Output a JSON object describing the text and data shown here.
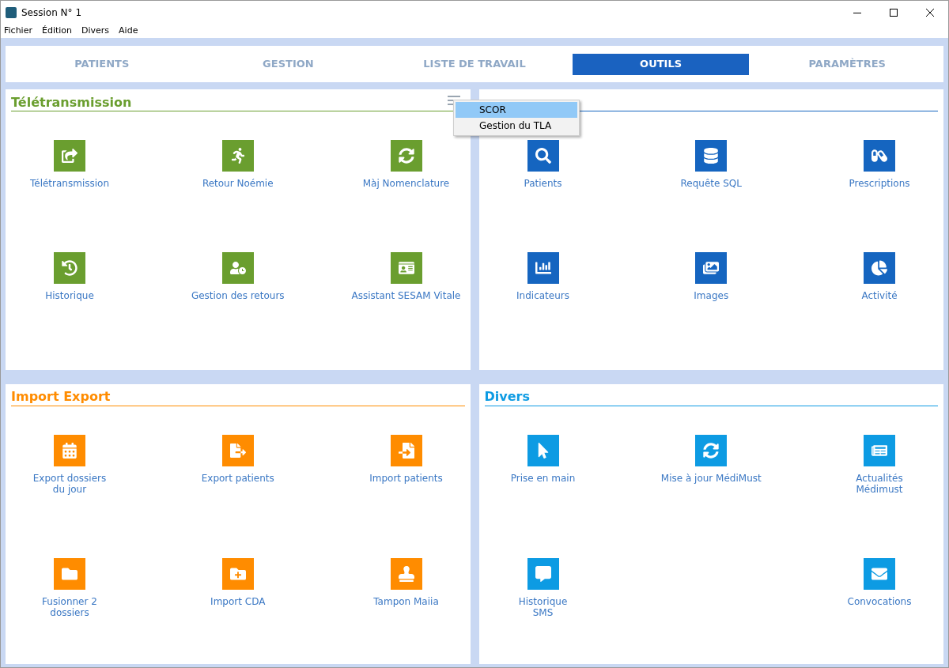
{
  "window": {
    "title": "Session N° 1"
  },
  "menu_bar": [
    "Fichier",
    "Édition",
    "Divers",
    "Aide"
  ],
  "tabs": [
    {
      "label": "PATIENTS",
      "selected": false
    },
    {
      "label": "GESTION",
      "selected": false
    },
    {
      "label": "LISTE DE TRAVAIL",
      "selected": false
    },
    {
      "label": "OUTILS",
      "selected": true
    },
    {
      "label": "PARAMÈTRES",
      "selected": false
    }
  ],
  "panels": [
    {
      "title": "Télétransmission",
      "color": "#6a9e2f",
      "has_menu": true,
      "tiles": [
        {
          "kind": "tile",
          "label": "Télétransmission"
        },
        {
          "kind": "tile",
          "label": "Retour Noémie"
        },
        {
          "kind": "tile",
          "label": "Màj Nomenclature"
        },
        {
          "kind": "tile",
          "label": "Historique"
        },
        {
          "kind": "tile",
          "label": "Gestion des retours"
        },
        {
          "kind": "tile",
          "label": "Assistant SESAM Vitale"
        }
      ]
    },
    {
      "color": "#1565c0",
      "has_menu": false,
      "tiles": [
        {
          "kind": "tile",
          "label": "Patients"
        },
        {
          "kind": "tile",
          "label": "Requête SQL"
        },
        {
          "kind": "tile",
          "label": "Prescriptions"
        },
        {
          "kind": "tile",
          "label": "Indicateurs"
        },
        {
          "kind": "tile",
          "label": "Images"
        },
        {
          "kind": "tile",
          "label": "Activité"
        }
      ]
    },
    {
      "title": "Import Export",
      "color": "#ff8c00",
      "has_menu": false,
      "tiles": [
        {
          "kind": "tile",
          "label": "Export dossiers\ndu jour"
        },
        {
          "kind": "tile",
          "label": "Export patients"
        },
        {
          "kind": "tile",
          "label": "Import patients"
        },
        {
          "kind": "tile",
          "label": "Fusionner 2\ndossiers"
        },
        {
          "kind": "tile",
          "label": "Import CDA"
        },
        {
          "kind": "tile",
          "label": "Tampon Maiia"
        }
      ]
    },
    {
      "title": "Divers",
      "color": "#0d9be3",
      "has_menu": false,
      "tiles": [
        {
          "kind": "tile",
          "label": "Prise en main"
        },
        {
          "kind": "tile",
          "label": "Mise à jour MédiMust"
        },
        {
          "kind": "tile",
          "label": "Actualités\nMédimust"
        },
        {
          "kind": "tile",
          "label": "Historique\nSMS"
        },
        {
          "kind": "blank"
        },
        {
          "kind": "tile",
          "label": "Convocations"
        }
      ]
    }
  ],
  "context_menu": {
    "items": [
      {
        "label": "SCOR",
        "selected": true
      },
      {
        "label": "Gestion du TLA",
        "selected": false
      }
    ]
  }
}
